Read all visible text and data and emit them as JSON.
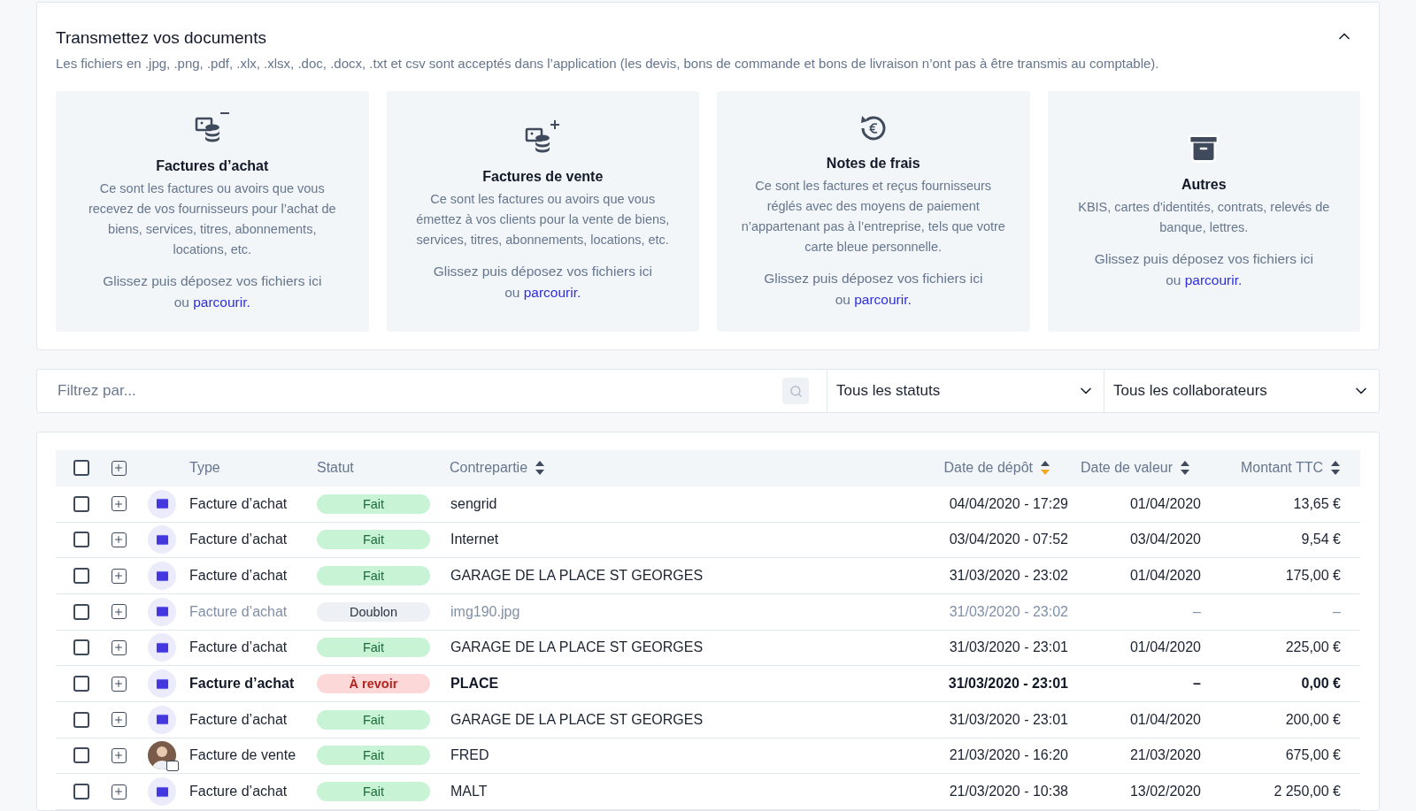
{
  "upload": {
    "title": "Transmettez vos documents",
    "subtitle": "Les fichiers en .jpg, .png, .pdf, .xlx, .xlsx, .doc, .docx, .txt et csv sont acceptés dans l’application (les devis, bons de commande et bons de livraison n’ont pas à être transmis au comptable).",
    "expanded": true,
    "categories": [
      {
        "kind": "purchase",
        "title": "Factures d’achat",
        "description": "Ce sont les factures ou avoirs que vous recevez de vos fournisseurs pour l’achat de biens, services, titres, abonnements, locations, etc.",
        "drop_text": "Glissez puis déposez vos fichiers ici",
        "or": "ou",
        "browse": "parcourir."
      },
      {
        "kind": "sale",
        "title": "Factures de vente",
        "description": "Ce sont les factures ou avoirs que vous émettez à vos clients pour la vente de biens, services, titres, abonnements, locations, etc.",
        "drop_text": "Glissez puis déposez vos fichiers ici",
        "or": "ou",
        "browse": "parcourir."
      },
      {
        "kind": "expense",
        "title": "Notes de frais",
        "description": "Ce sont les factures et reçus fournisseurs réglés avec des moyens de paiement n’appartenant pas à l’entreprise, tels que votre carte bleue personnelle.",
        "drop_text": "Glissez puis déposez vos fichiers ici",
        "or": "ou",
        "browse": "parcourir."
      },
      {
        "kind": "other",
        "title": "Autres",
        "description": "KBIS, cartes d'identités, contrats, relevés de banque, lettres.",
        "drop_text": "Glissez puis déposez vos fichiers ici",
        "or": "ou",
        "browse": "parcourir."
      }
    ]
  },
  "filters": {
    "search_placeholder": "Filtrez par...",
    "status": "Tous les statuts",
    "collaborator": "Tous les collaborateurs"
  },
  "table": {
    "select_all_checked": false,
    "columns": [
      {
        "label": "Type",
        "kind": "plain"
      },
      {
        "label": "Statut",
        "kind": "plain"
      },
      {
        "label": "Contrepartie",
        "kind": "sortable"
      },
      {
        "label": "Date de dépôt",
        "kind": "sorted"
      },
      {
        "label": "Date de valeur",
        "kind": "sortable"
      },
      {
        "label": "Montant TTC",
        "kind": "sortable"
      }
    ],
    "rows": [
      {
        "kind": "mail",
        "checked": false,
        "type": "Facture d’achat",
        "status": {
          "kind": "done",
          "label": "Fait"
        },
        "counterpart": "sengrid",
        "deposit_date": "04/04/2020 - 17:29",
        "value_date": "01/04/2020",
        "amount": "13,65 €"
      },
      {
        "kind": "mail",
        "checked": false,
        "type": "Facture d’achat",
        "status": {
          "kind": "done",
          "label": "Fait"
        },
        "counterpart": "Internet",
        "deposit_date": "03/04/2020 - 07:52",
        "value_date": "03/04/2020",
        "amount": "9,54 €"
      },
      {
        "kind": "mail",
        "checked": false,
        "type": "Facture d’achat",
        "status": {
          "kind": "done",
          "label": "Fait"
        },
        "counterpart": "GARAGE DE LA PLACE ST GEORGES",
        "deposit_date": "31/03/2020 - 23:02",
        "value_date": "01/04/2020",
        "amount": "175,00 €"
      },
      {
        "kind": "mail",
        "checked": false,
        "type": "Facture d’achat",
        "status": {
          "kind": "duplicate",
          "label": "Doublon"
        },
        "counterpart": "img190.jpg",
        "deposit_date": "31/03/2020 - 23:02",
        "value_date": "–",
        "amount": "–"
      },
      {
        "kind": "mail",
        "checked": false,
        "type": "Facture d’achat",
        "status": {
          "kind": "done",
          "label": "Fait"
        },
        "counterpart": "GARAGE DE LA PLACE ST GEORGES",
        "deposit_date": "31/03/2020 - 23:01",
        "value_date": "01/04/2020",
        "amount": "225,00 €"
      },
      {
        "kind": "mail",
        "checked": false,
        "type": "Facture d’achat",
        "status": {
          "kind": "review",
          "label": "À revoir"
        },
        "counterpart": "PLACE",
        "deposit_date": "31/03/2020 - 23:01",
        "value_date": "–",
        "amount": "0,00 €"
      },
      {
        "kind": "mail",
        "checked": false,
        "type": "Facture d’achat",
        "status": {
          "kind": "done",
          "label": "Fait"
        },
        "counterpart": "GARAGE DE LA PLACE ST GEORGES",
        "deposit_date": "31/03/2020 - 23:01",
        "value_date": "01/04/2020",
        "amount": "200,00 €"
      },
      {
        "kind": "user",
        "checked": false,
        "type": "Facture de vente",
        "status": {
          "kind": "done",
          "label": "Fait"
        },
        "counterpart": "FRED",
        "deposit_date": "21/03/2020 - 16:20",
        "value_date": "21/03/2020",
        "amount": "675,00 €"
      },
      {
        "kind": "mail",
        "checked": false,
        "type": "Facture d’achat",
        "status": {
          "kind": "done",
          "label": "Fait"
        },
        "counterpart": "MALT",
        "deposit_date": "21/03/2020 - 10:38",
        "value_date": "13/02/2020",
        "amount": "2 250,00 €"
      }
    ]
  }
}
